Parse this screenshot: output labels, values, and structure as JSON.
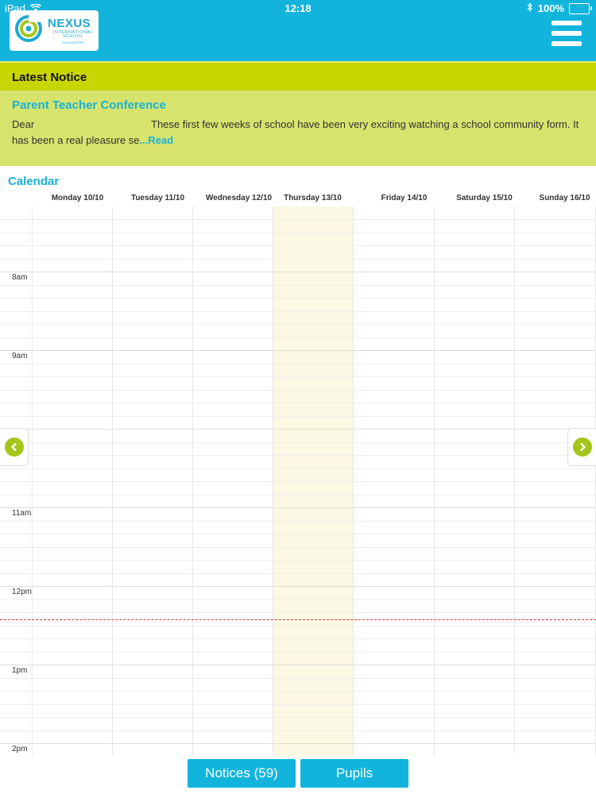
{
  "status": {
    "device": "iPad",
    "time": "12:18",
    "battery": "100%"
  },
  "header": {
    "logo_name": "NEXUS",
    "logo_sub": "INTERNATIONAL SCHOOL",
    "logo_country": "SINGAPORE",
    "menu_icon": "hamburger-menu-icon"
  },
  "notice": {
    "section_title": "Latest Notice",
    "title": "Parent Teacher Conference",
    "salutation": "Dear",
    "body": "These first few weeks of school have been very exciting watching a school community form. It has been a real pleasure se",
    "read_link": "...Read"
  },
  "calendar": {
    "title": "Calendar",
    "days": [
      "Monday 10/10",
      "Tuesday 11/10",
      "Wednesday 12/10",
      "Thursday 13/10",
      "Friday 14/10",
      "Saturday 15/10",
      "Sunday 16/10"
    ],
    "today_index": 3,
    "time_labels": [
      "8am",
      "9am",
      "11am",
      "12pm",
      "1pm",
      "2pm"
    ],
    "accent_color": "#12b4dc",
    "today_color": "#fbf8e3",
    "now_line_color": "#e23b3b"
  },
  "buttons": {
    "notices": "Notices (59)",
    "pupils": "Pupils"
  }
}
